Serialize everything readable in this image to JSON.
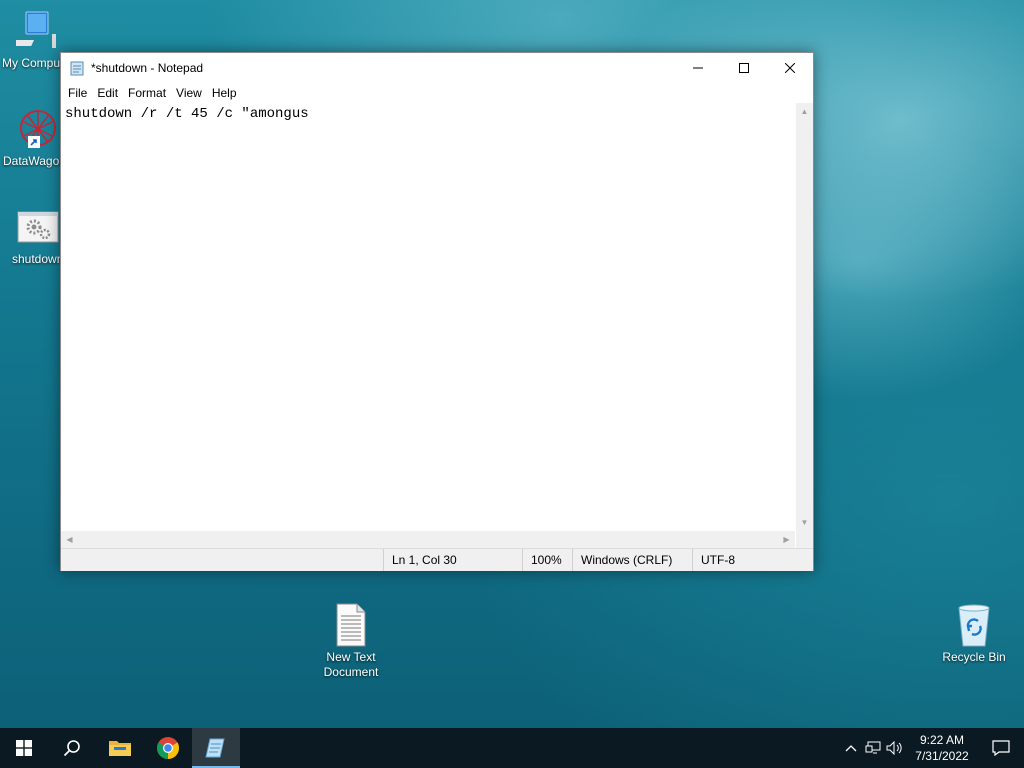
{
  "desktop": {
    "icons": [
      {
        "label": "My Computer"
      },
      {
        "label": "DataWagon"
      },
      {
        "label": "shutdown"
      },
      {
        "label": "New Text Document"
      },
      {
        "label": "Recycle Bin"
      }
    ]
  },
  "notepad": {
    "title": "*shutdown - Notepad",
    "menus": [
      "File",
      "Edit",
      "Format",
      "View",
      "Help"
    ],
    "content": "shutdown /r /t 45 /c \"amongus",
    "status": {
      "position": "Ln 1, Col 30",
      "zoom": "100%",
      "line_endings": "Windows (CRLF)",
      "encoding": "UTF-8"
    }
  },
  "taskbar": {
    "items": [
      "start-icon",
      "search-icon",
      "file-explorer-icon",
      "chrome-icon",
      "notepad-icon"
    ],
    "clock": {
      "time": "9:22 AM",
      "date": "7/31/2022"
    }
  },
  "colors": {
    "taskbar": "#0b1a22",
    "accent": "#76b9ed"
  }
}
